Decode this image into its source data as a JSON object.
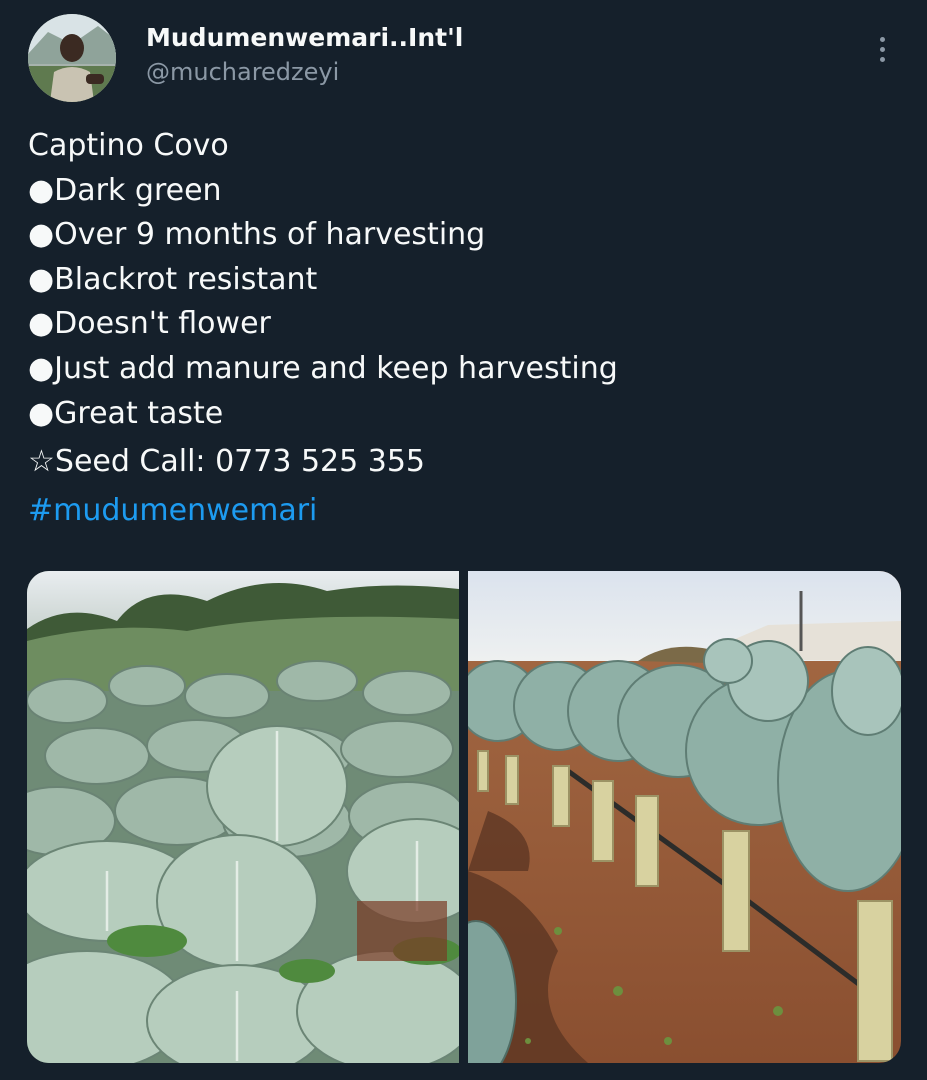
{
  "author": {
    "display_name": "Mudumenwemari..Int'l",
    "handle": "@mucharedzeyi"
  },
  "tweet": {
    "lines": [
      "Captino Covo",
      "●Dark green",
      "●Over 9 months of harvesting",
      "●Blackrot resistant",
      "●Doesn't flower",
      "●Just add manure and keep harvesting",
      "●Great taste",
      "☆Seed Call: 0773 525 355"
    ],
    "hashtag": "#mudumenwemari"
  },
  "media": {
    "photos": [
      {
        "description_icon": "photo-icon"
      },
      {
        "description_icon": "photo-icon"
      }
    ]
  },
  "icons": {
    "more": "more-options-icon"
  },
  "colors": {
    "background": "#15202b",
    "text": "#f7f9f9",
    "secondary_text": "#8b98a5",
    "link": "#1d9bf0"
  }
}
